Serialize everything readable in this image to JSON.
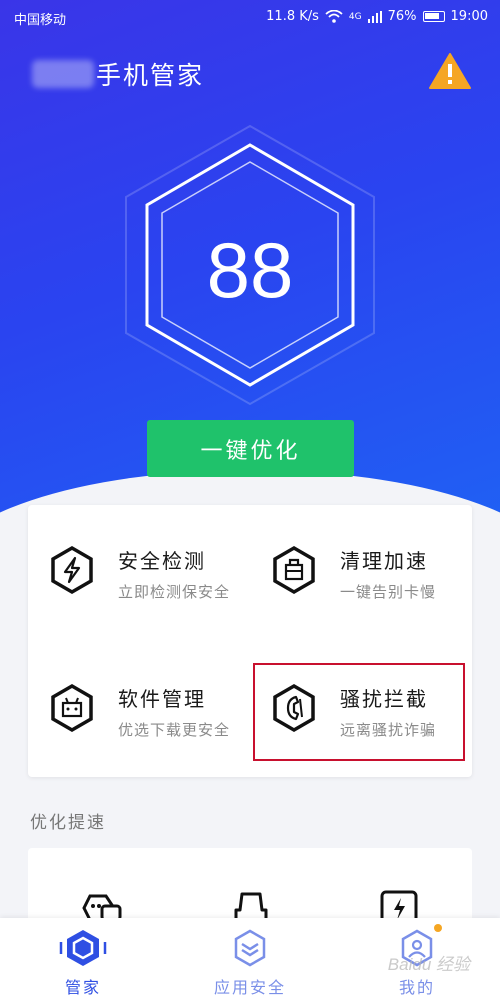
{
  "status_bar": {
    "carrier": "中国移动",
    "speed": "11.8 K/s",
    "network": "4G",
    "battery": "76%",
    "time": "19:00"
  },
  "header": {
    "app_title": "手机管家",
    "warning_icon": "warning-icon"
  },
  "score": {
    "value": "88"
  },
  "optimize_button": "一键优化",
  "features": [
    {
      "title": "安全检测",
      "subtitle": "立即检测保安全",
      "icon": "lightning-hexagon-icon"
    },
    {
      "title": "清理加速",
      "subtitle": "一键告别卡慢",
      "icon": "trash-hexagon-icon"
    },
    {
      "title": "软件管理",
      "subtitle": "优选下载更安全",
      "icon": "robot-hexagon-icon"
    },
    {
      "title": "骚扰拦截",
      "subtitle": "远离骚扰诈骗",
      "icon": "phone-hexagon-icon"
    }
  ],
  "section_title": "优化提速",
  "tabs": [
    {
      "label": "管家",
      "icon": "home-hexagon-icon",
      "active": true
    },
    {
      "label": "应用安全",
      "icon": "app-shield-icon",
      "active": false
    },
    {
      "label": "我的",
      "icon": "user-hexagon-icon",
      "active": false
    }
  ],
  "watermark": "Baidu 经验",
  "colors": {
    "hero_top": "#3a35e8",
    "hero_bottom": "#1f63f4",
    "button_green": "#1fc26b",
    "highlight_red": "#c8102e",
    "tab_active": "#2f4fe3",
    "badge": "#f5a623"
  }
}
